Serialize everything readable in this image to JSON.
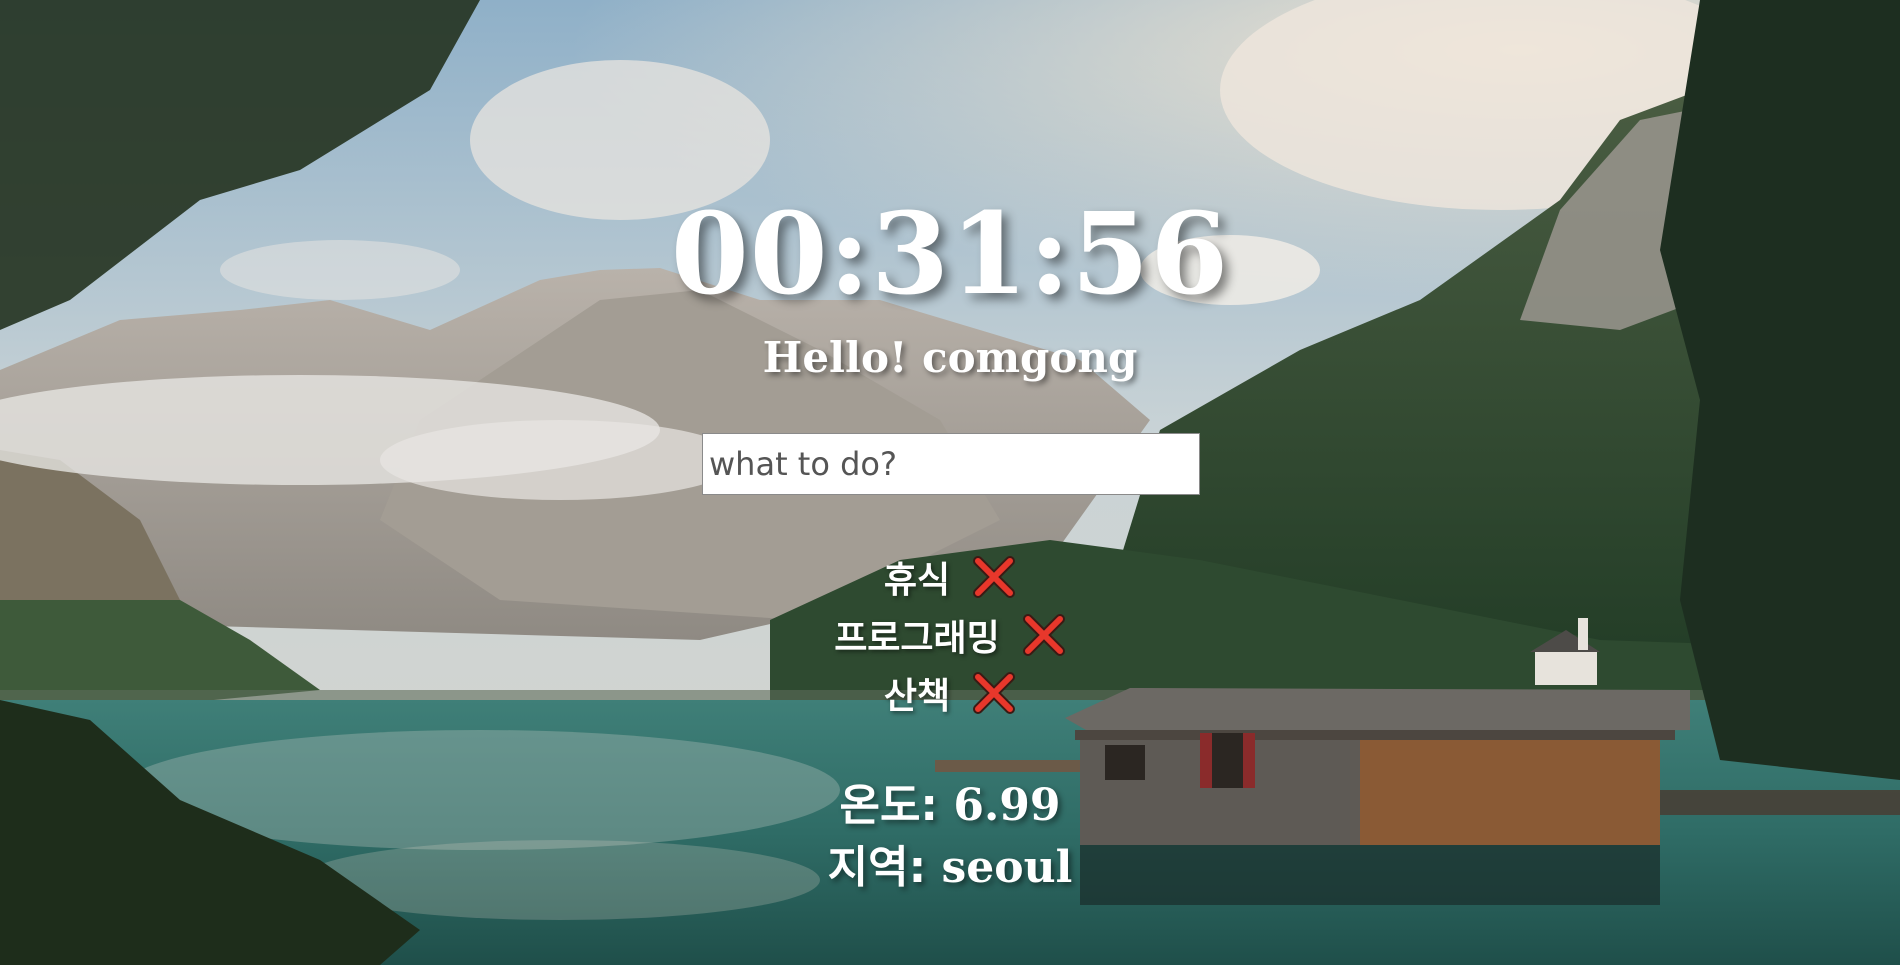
{
  "clock": {
    "time": "00:31:56"
  },
  "greeting": {
    "text": "Hello! comgong"
  },
  "todo_form": {
    "placeholder": "what to do?",
    "value": ""
  },
  "todos": [
    {
      "text": "휴식",
      "delete_icon": "close-icon"
    },
    {
      "text": "프로그래밍",
      "delete_icon": "close-icon"
    },
    {
      "text": "산책",
      "delete_icon": "close-icon"
    }
  ],
  "weather": {
    "temp_label": "온도:",
    "temp_value": "6.99",
    "city_label": "지역:",
    "city_value": "seoul"
  },
  "colors": {
    "delete_icon": "#e8372b",
    "text": "#ffffff"
  },
  "background": {
    "scene": "mountain-lake-boathouse-photo"
  }
}
